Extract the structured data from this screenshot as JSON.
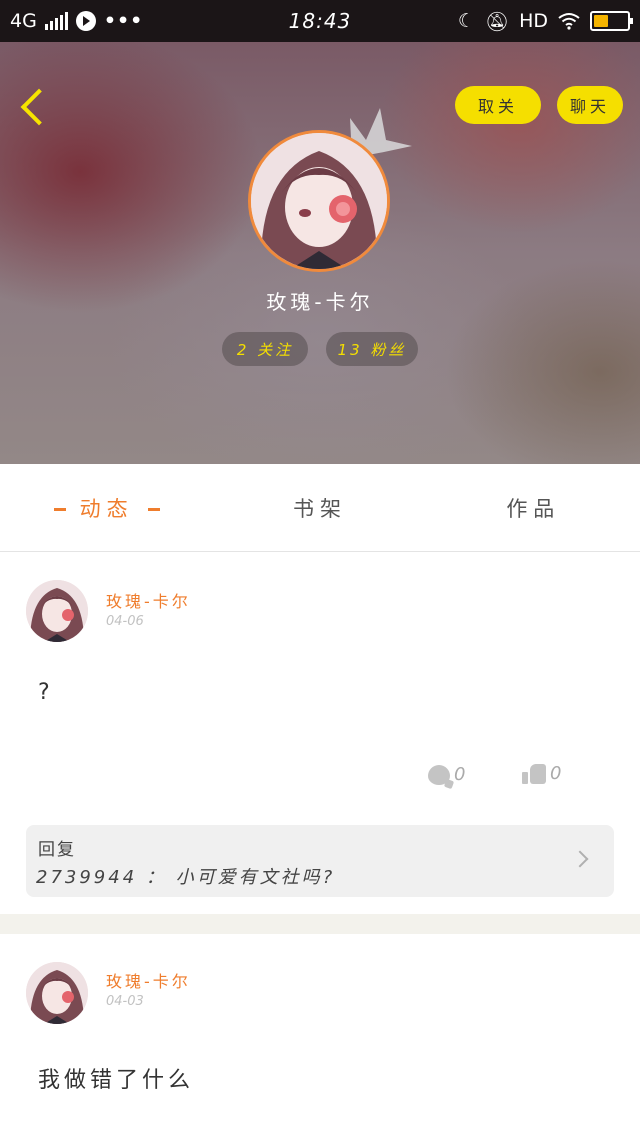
{
  "status_bar": {
    "network": "4G",
    "time": "18:43",
    "hd": "HD"
  },
  "header": {
    "unfollow_label": "取关",
    "chat_label": "聊天",
    "user_name": "玫瑰-卡尔",
    "following": "2 关注",
    "fans": "13 粉丝"
  },
  "tabs": [
    {
      "label": "动态",
      "active": true
    },
    {
      "label": "书架",
      "active": false
    },
    {
      "label": "作品",
      "active": false
    }
  ],
  "posts": [
    {
      "author": "玫瑰-卡尔",
      "date": "04-06",
      "text": "?",
      "comments": "0",
      "likes": "0",
      "reply_label": "回复",
      "reply_text": "2739944 ： 小可爱有文社吗?"
    },
    {
      "author": "玫瑰-卡尔",
      "date": "04-03",
      "text": "我做错了什么"
    }
  ],
  "colors": {
    "accent": "#ef7d2d",
    "button_yellow": "#f5df00",
    "status_bar": "#1b1517"
  }
}
